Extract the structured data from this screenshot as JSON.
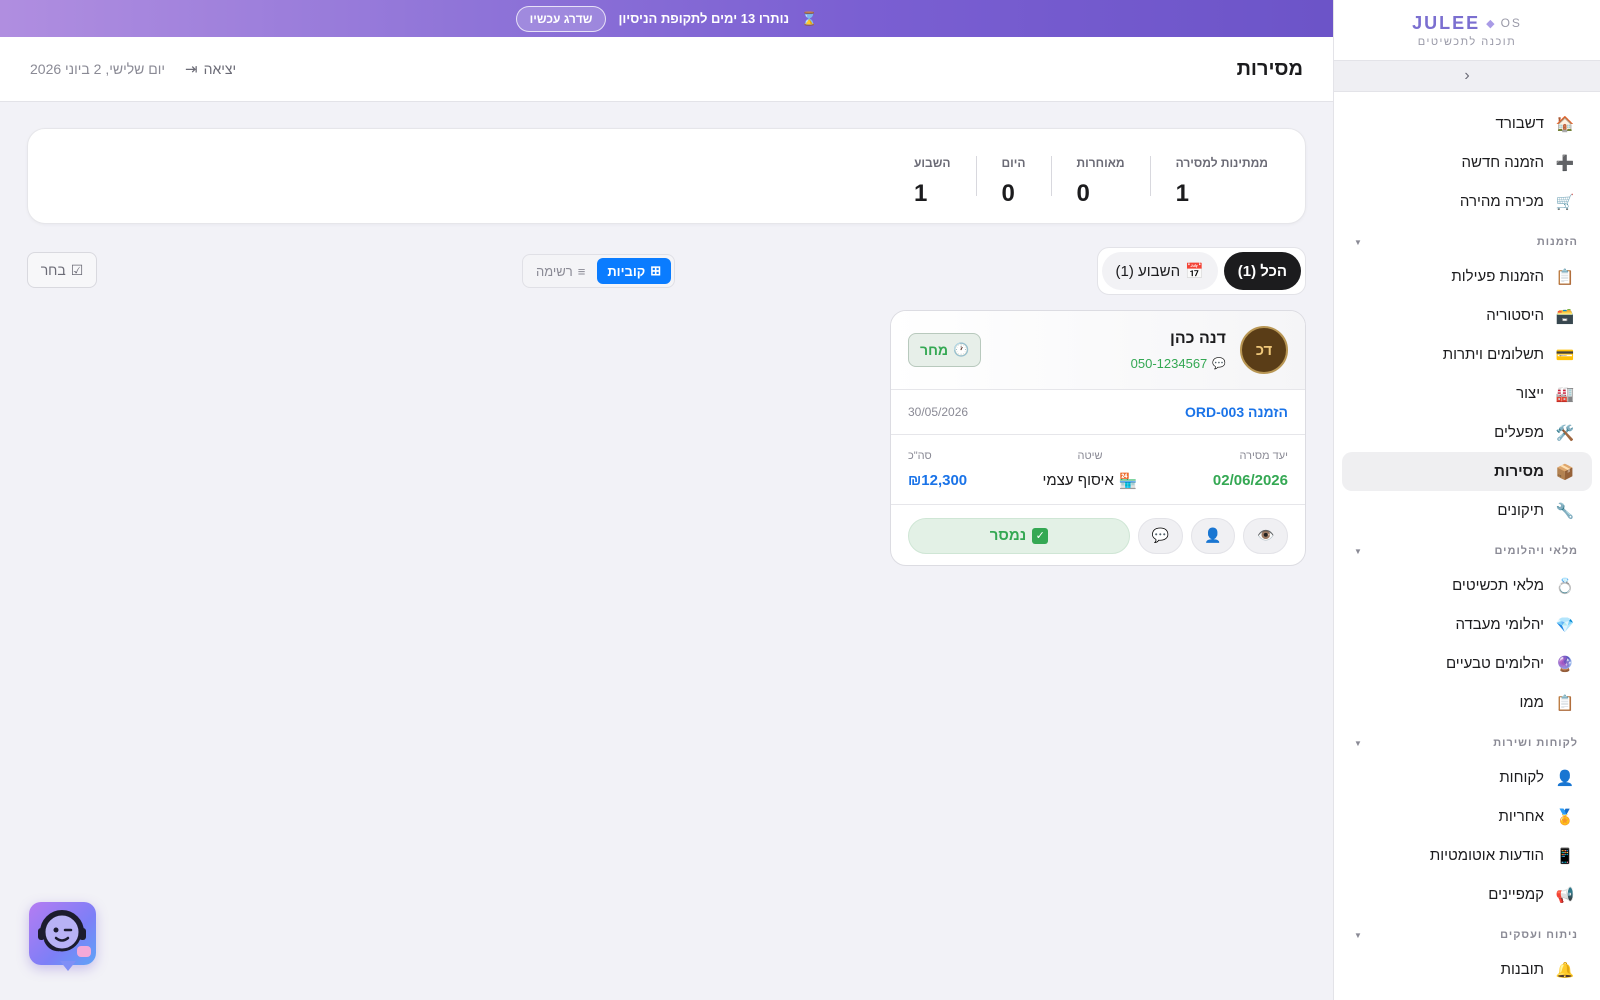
{
  "banner": {
    "icon": "hourglass-icon",
    "text": "נותרו 13 ימים לתקופת הניסיון",
    "upgrade_label": "שדרג עכשיו"
  },
  "brand": {
    "name": "JULEE",
    "os": "OS",
    "subtitle": "תוכנה לתכשיטים"
  },
  "header": {
    "title": "מסירות",
    "logout_label": "יציאה",
    "date": "יום שלישי, 2 ביוני 2026"
  },
  "sidebar": {
    "top_items": [
      {
        "icon": "🏠",
        "label": "דשבורד"
      },
      {
        "icon": "➕",
        "label": "הזמנה חדשה"
      },
      {
        "icon": "🛒",
        "label": "מכירה מהירה"
      }
    ],
    "sections": [
      {
        "title": "הזמנות",
        "items": [
          {
            "icon": "📋",
            "label": "הזמנות פעילות"
          },
          {
            "icon": "🗃️",
            "label": "היסטוריה"
          },
          {
            "icon": "💳",
            "label": "תשלומים ויתרות"
          },
          {
            "icon": "🏭",
            "label": "ייצור"
          },
          {
            "icon": "🛠️",
            "label": "מפעלים"
          },
          {
            "icon": "📦",
            "label": "מסירות",
            "active": true
          },
          {
            "icon": "🔧",
            "label": "תיקונים"
          }
        ]
      },
      {
        "title": "מלאי ויהלומים",
        "items": [
          {
            "icon": "💍",
            "label": "מלאי תכשיטים"
          },
          {
            "icon": "💎",
            "label": "יהלומי מעבדה"
          },
          {
            "icon": "🔮",
            "label": "יהלומים טבעיים"
          },
          {
            "icon": "📋",
            "label": "ממו"
          }
        ]
      },
      {
        "title": "לקוחות ושירות",
        "items": [
          {
            "icon": "👤",
            "label": "לקוחות"
          },
          {
            "icon": "🏅",
            "label": "אחריות"
          },
          {
            "icon": "📱",
            "label": "הודעות אוטומטיות"
          },
          {
            "icon": "📢",
            "label": "קמפיינים"
          }
        ]
      },
      {
        "title": "ניתוח ועסקים",
        "items": [
          {
            "icon": "🔔",
            "label": "תובנות"
          }
        ]
      }
    ]
  },
  "stats": [
    {
      "label": "ממתינות למסירה",
      "value": "1"
    },
    {
      "label": "מאוחרות",
      "value": "0"
    },
    {
      "label": "היום",
      "value": "0"
    },
    {
      "label": "השבוע",
      "value": "1"
    }
  ],
  "filters": {
    "all_label": "הכל (1)",
    "week_label": "השבוע (1)",
    "week_icon": "📅"
  },
  "view_toggle": {
    "cards_label": "קוביות",
    "cards_icon": "⊞",
    "list_label": "רשימה",
    "list_icon": "≡"
  },
  "select_button": {
    "label": "בחר",
    "icon": "☑"
  },
  "delivery_card": {
    "avatar_initials": "דכ",
    "customer_name": "דנה כהן",
    "phone": "050-1234567",
    "phone_icon": "💬",
    "due_icon": "🕐",
    "due_label": "מחר",
    "order_label": "הזמנה ORD-003",
    "order_date": "30/05/2026",
    "target_label": "יעד מסירה",
    "target_value": "02/06/2026",
    "method_label": "שיטה",
    "method_icon": "🏪",
    "method_value": "איסוף עצמי",
    "total_label": "סה\"כ",
    "total_value": "₪12,300",
    "actions": {
      "view_icon": "👁️",
      "customer_icon": "👤",
      "message_icon": "💬",
      "delivered_icon": "✓",
      "delivered_label": "נמסר"
    }
  }
}
